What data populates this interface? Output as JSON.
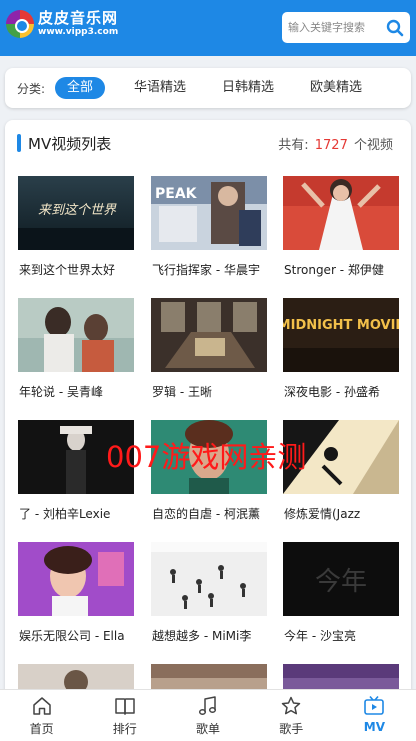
{
  "header": {
    "site_name": "皮皮音乐网",
    "site_url": "www.vipp3.com",
    "search_placeholder": "输入关键字搜索"
  },
  "filter": {
    "label": "分类:",
    "categories": [
      "全部",
      "华语精选",
      "日韩精选",
      "欧美精选"
    ],
    "active": "全部"
  },
  "list": {
    "title": "MV视频列表",
    "total_prefix": "共有:",
    "total_count": "1727",
    "total_suffix": "个视频",
    "videos": [
      {
        "title": "来到这个世界太好",
        "thumb_text": "来到这个世界"
      },
      {
        "title": "飞行指挥家 - 华晨宇",
        "thumb_text": "PEAK"
      },
      {
        "title": "Stronger - 郑伊健",
        "thumb_text": ""
      },
      {
        "title": "年轮说 - 吴青峰",
        "thumb_text": ""
      },
      {
        "title": "罗辑 - 王晰",
        "thumb_text": ""
      },
      {
        "title": "深夜电影 - 孙盛希",
        "thumb_text": "MIDNIGHT MOVIE"
      },
      {
        "title": "了 - 刘柏辛Lexie",
        "thumb_text": ""
      },
      {
        "title": "自恋的自虐 - 柯泯薰",
        "thumb_text": ""
      },
      {
        "title": "修炼爱情(Jazz",
        "thumb_text": ""
      },
      {
        "title": "娱乐无限公司 - Ella",
        "thumb_text": ""
      },
      {
        "title": "越想越多 - MiMi李",
        "thumb_text": ""
      },
      {
        "title": "今年 - 沙宝亮",
        "thumb_text": "今年"
      }
    ]
  },
  "watermark": "007游戏网亲测",
  "tabbar": {
    "tabs": [
      {
        "label": "首页",
        "icon": "home-icon"
      },
      {
        "label": "排行",
        "icon": "book-icon"
      },
      {
        "label": "歌单",
        "icon": "music-note-icon"
      },
      {
        "label": "歌手",
        "icon": "star-icon"
      },
      {
        "label": "MV",
        "icon": "tv-icon"
      }
    ],
    "active": "MV"
  },
  "colors": {
    "primary": "#1e88e5",
    "count": "#e53935",
    "watermark": "#ff1a1a"
  }
}
